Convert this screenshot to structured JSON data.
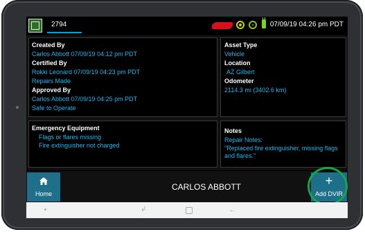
{
  "status_bar": {
    "unit_number": "2794",
    "datetime": "07/09/19 04:26 pm PDT"
  },
  "dvir": {
    "created_by_label": "Created By",
    "created_by_value": "Carlos Abbott 07/09/19 04:12 pm PDT",
    "certified_by_label": "Certified By",
    "certified_by_value": "Rokki Leonard 07/09/19 04:23 pm PDT",
    "certified_status": "Repairs Made",
    "approved_by_label": "Approved By",
    "approved_by_value": "Carlos Abbott 07/09/19 04:25 pm PDT",
    "approved_status": "Safe to Operate",
    "asset_type_label": "Asset Type",
    "asset_type_value": "Vehicle",
    "location_label": "Location",
    "location_value": "AZ Gilbert",
    "odometer_label": "Odometer",
    "odometer_value": "2114.3 mi (3402.6 km)",
    "emergency_label": "Emergency Equipment",
    "emergency_items": [
      "Flags or flares missing",
      "Fire extinguisher not charged"
    ],
    "notes_label": "Notes",
    "notes_title": "Repair Notes:",
    "notes_text": "\"Replaced fire extinguisher, missing flags and flares.\""
  },
  "bottom_bar": {
    "home_label": "Home",
    "driver_name": "CARLOS ABBOTT",
    "add_dvir_plus": "+",
    "add_dvir_label": "Add DVIR"
  },
  "icons": {
    "app": "app-logo-icon",
    "alert": "red-alert-icon",
    "gps": "gps-icon",
    "signal": "signal-icon",
    "power": "power-plug-icon",
    "home": "home-icon"
  },
  "colors": {
    "accent_blue": "#19b8f0",
    "button_teal": "#1e6f8a",
    "highlight_green": "#13a74a",
    "alert_red": "#d9101a"
  }
}
